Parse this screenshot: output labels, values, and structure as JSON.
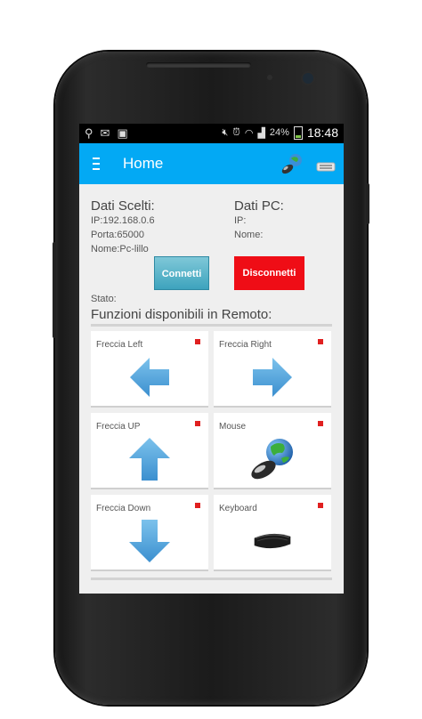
{
  "status_bar": {
    "battery_percent": "24%",
    "time": "18:48"
  },
  "app_bar": {
    "title": "Home"
  },
  "selected_data": {
    "heading": "Dati Scelti:",
    "ip": "IP:192.168.0.6",
    "port": "Porta:65000",
    "name": "Nome:Pc-lillo"
  },
  "pc_data": {
    "heading": "Dati PC:",
    "ip": "IP:",
    "name": "Nome:"
  },
  "buttons": {
    "connect": "Connetti",
    "disconnect": "Disconnetti"
  },
  "status_label": "Stato:",
  "functions_heading": "Funzioni disponibili in Remoto:",
  "functions": [
    {
      "label": "Freccia Left",
      "icon": "arrow-left-icon"
    },
    {
      "label": "Freccia Right",
      "icon": "arrow-right-icon"
    },
    {
      "label": "Freccia UP",
      "icon": "arrow-up-icon"
    },
    {
      "label": "Mouse",
      "icon": "mouse-globe-icon"
    },
    {
      "label": "Freccia Down",
      "icon": "arrow-down-icon"
    },
    {
      "label": "Keyboard",
      "icon": "keyboard-icon"
    }
  ],
  "colors": {
    "app_bar": "#03a9f4",
    "connect_button": "#4fb0c6",
    "disconnect_button": "#ef0d16",
    "arrow_blue": "#4a9fd5",
    "indicator_red": "#e02020"
  }
}
